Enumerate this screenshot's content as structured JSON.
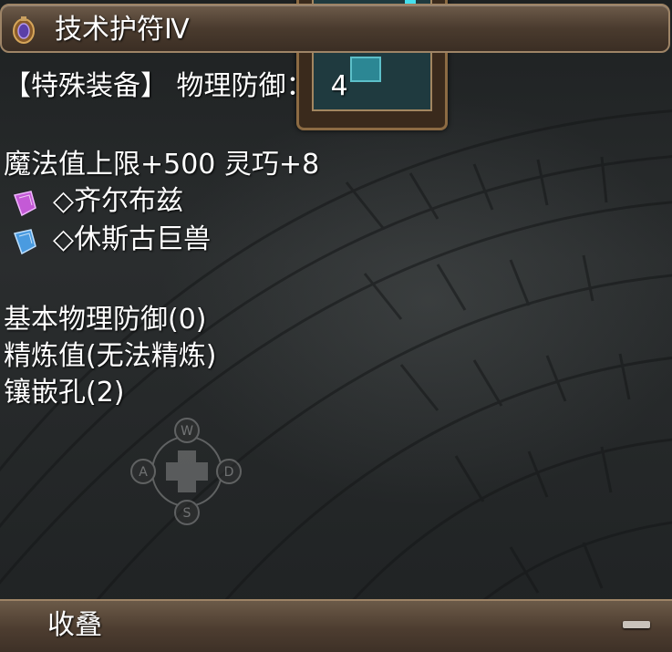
{
  "item": {
    "name": "技术护符Ⅳ",
    "icon": "amulet-icon"
  },
  "stats": {
    "category": "【特殊装备】",
    "defense_label": "物理防御：",
    "defense_value": "4",
    "bonus_line": "魔法值上限+500 灵巧+8"
  },
  "sockets": [
    {
      "label": "◇齐尔布兹",
      "icon": "pink-crystal-icon",
      "color": "#c45ad6"
    },
    {
      "label": "◇休斯古巨兽",
      "icon": "blue-crystal-icon",
      "color": "#4a9be0"
    }
  ],
  "details": {
    "base_defense": "基本物理防御(0)",
    "refine": "精炼值(无法精炼)",
    "slots": "镶嵌孔(2)"
  },
  "compass": {
    "north": "W",
    "west": "A",
    "east": "D",
    "south": "S"
  },
  "footer": {
    "collapse_label": "收叠",
    "collapse_icon": "minus-icon"
  }
}
